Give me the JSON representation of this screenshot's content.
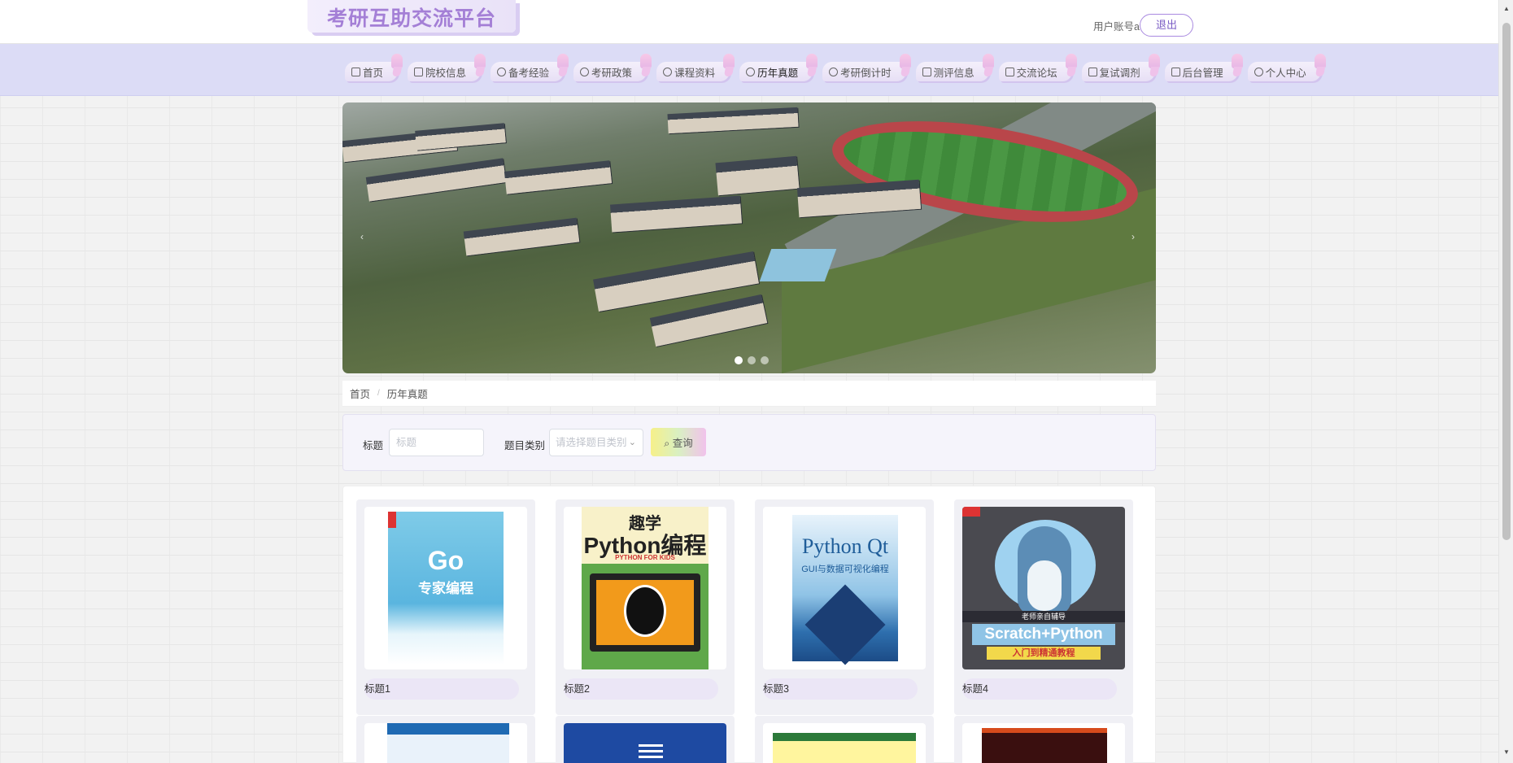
{
  "header": {
    "brand_title": "考研互助交流平台",
    "user_label": "用户账号a",
    "logout_label": "退出"
  },
  "nav": {
    "items": [
      {
        "label": "首页",
        "icon": "home-icon",
        "active": false
      },
      {
        "label": "院校信息",
        "icon": "bag-icon",
        "active": false
      },
      {
        "label": "备考经验",
        "icon": "info-icon",
        "active": false
      },
      {
        "label": "考研政策",
        "icon": "question-icon",
        "active": false
      },
      {
        "label": "课程资料",
        "icon": "info-icon",
        "active": false
      },
      {
        "label": "历年真题",
        "icon": "settings-icon",
        "active": true
      },
      {
        "label": "考研倒计时",
        "icon": "check-circle-icon",
        "active": false
      },
      {
        "label": "测评信息",
        "icon": "camera-icon",
        "active": false
      },
      {
        "label": "交流论坛",
        "icon": "cloud-icon",
        "active": false
      },
      {
        "label": "复试调剂",
        "icon": "video-icon",
        "active": false
      },
      {
        "label": "后台管理",
        "icon": "briefcase-icon",
        "active": false
      },
      {
        "label": "个人中心",
        "icon": "user-icon",
        "active": false
      }
    ]
  },
  "banner": {
    "prev_icon": "chevron-left-icon",
    "next_icon": "chevron-right-icon",
    "slide_count": 3,
    "active_slide": 1
  },
  "breadcrumb": {
    "home": "首页",
    "separator": "/",
    "current": "历年真题"
  },
  "search": {
    "title_label": "标题",
    "title_placeholder": "标题",
    "title_value": "",
    "category_label": "题目类别",
    "category_placeholder": "请选择题目类别",
    "query_button": "查询",
    "query_icon": "search-icon"
  },
  "list": {
    "items": [
      {
        "title": "标题1",
        "cover_text_main": "Go",
        "cover_text_sub": "专家编程"
      },
      {
        "title": "标题2",
        "cover_text_main": "Python编程",
        "cover_text_sub": "趣学",
        "cover_text_tag": "PYTHON FOR KIDS"
      },
      {
        "title": "标题3",
        "cover_text_main": "Python Qt",
        "cover_text_sub": "GUI与数据可视化编程"
      },
      {
        "title": "标题4",
        "cover_text_main": "Scratch+Python",
        "cover_text_sub": "入门到精通教程",
        "cover_text_tag": "老师亲自辅导"
      }
    ]
  },
  "colors": {
    "accent": "#a47fd6",
    "nav_background": "#dcdcf6",
    "logout_border": "#a98ae0"
  }
}
